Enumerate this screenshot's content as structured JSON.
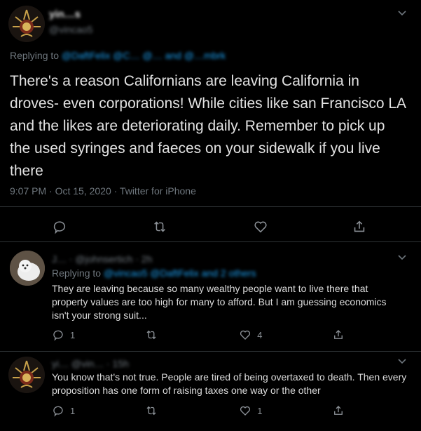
{
  "main_tweet": {
    "display_name": "yin…s",
    "handle": "@vincao5",
    "replying_to_prefix": "Replying to",
    "replying_to_users": "@DaftFelix @C… @… and @…mbrk",
    "text": "There's a reason Californians are leaving California in droves- even corporations! While cities like san Francisco LA and the likes are deteriorating daily. Remember to pick up the used syringes and faeces on your sidewalk if you live there",
    "timestamp": "9:07 PM · Oct 15, 2020 · Twitter for iPhone"
  },
  "reply1": {
    "header": "J… · @johnsertich · 2h",
    "replying_to_prefix": "Replying to",
    "replying_to_users": "@vincao5 @DaftFelix and 2 others",
    "text": "They are leaving because so many wealthy people want to live there that property values are too high for many to afford. But I am guessing economics isn't your strong suit...",
    "reply_count": "1",
    "retweet_count": "",
    "like_count": "4"
  },
  "reply2": {
    "header": "yi… @vin… · 15h",
    "text": "You know that's not true. People are tired  of being overtaxed to death. Then every proposition has one form of raising taxes one way or the other",
    "reply_count": "1",
    "retweet_count": "",
    "like_count": "1"
  },
  "icons": [
    "reply-icon",
    "retweet-icon",
    "like-icon",
    "share-icon",
    "chevron-down-icon"
  ],
  "colors": {
    "background": "#000000",
    "text": "#d9d9d9",
    "muted": "#6e767d",
    "link": "#1da1f2",
    "divider": "#2f3336"
  }
}
